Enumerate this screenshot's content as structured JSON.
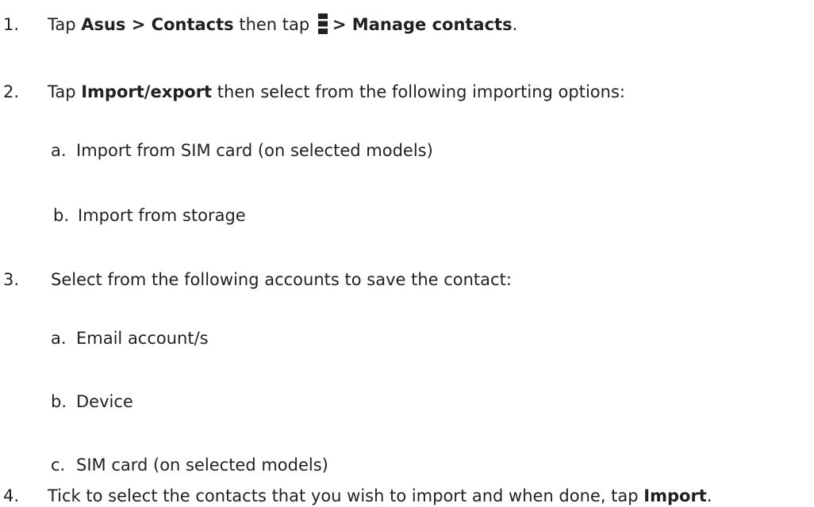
{
  "steps": [
    {
      "number": "1.",
      "parts": {
        "p1": "Tap ",
        "b1": "Asus",
        "p2": " > ",
        "b2": "Contacts",
        "p3": " then tap ",
        "icon": "overflow-menu-icon",
        "b3": "> Manage contacts",
        "p4": "."
      }
    },
    {
      "number": "2.",
      "parts": {
        "p1": "Tap ",
        "b1": "Import/export",
        "p2": " then select from the following importing options:"
      },
      "subitems": [
        {
          "letter": "a.",
          "text": "Import from SIM card (on selected models)"
        },
        {
          "letter": "b.",
          "text": "Import from storage"
        }
      ]
    },
    {
      "number": "3.",
      "parts": {
        "p1": "Select from the following accounts to save the contact:"
      },
      "subitems": [
        {
          "letter": "a.",
          "text": "Email account/s"
        },
        {
          "letter": "b.",
          "text": "Device"
        },
        {
          "letter": "c.",
          "text": "SIM card (on selected models)"
        }
      ]
    },
    {
      "number": "4.",
      "parts": {
        "p1": "Tick to select the contacts that you wish to import and when done, tap ",
        "b1": "Import",
        "p2": "."
      }
    }
  ]
}
